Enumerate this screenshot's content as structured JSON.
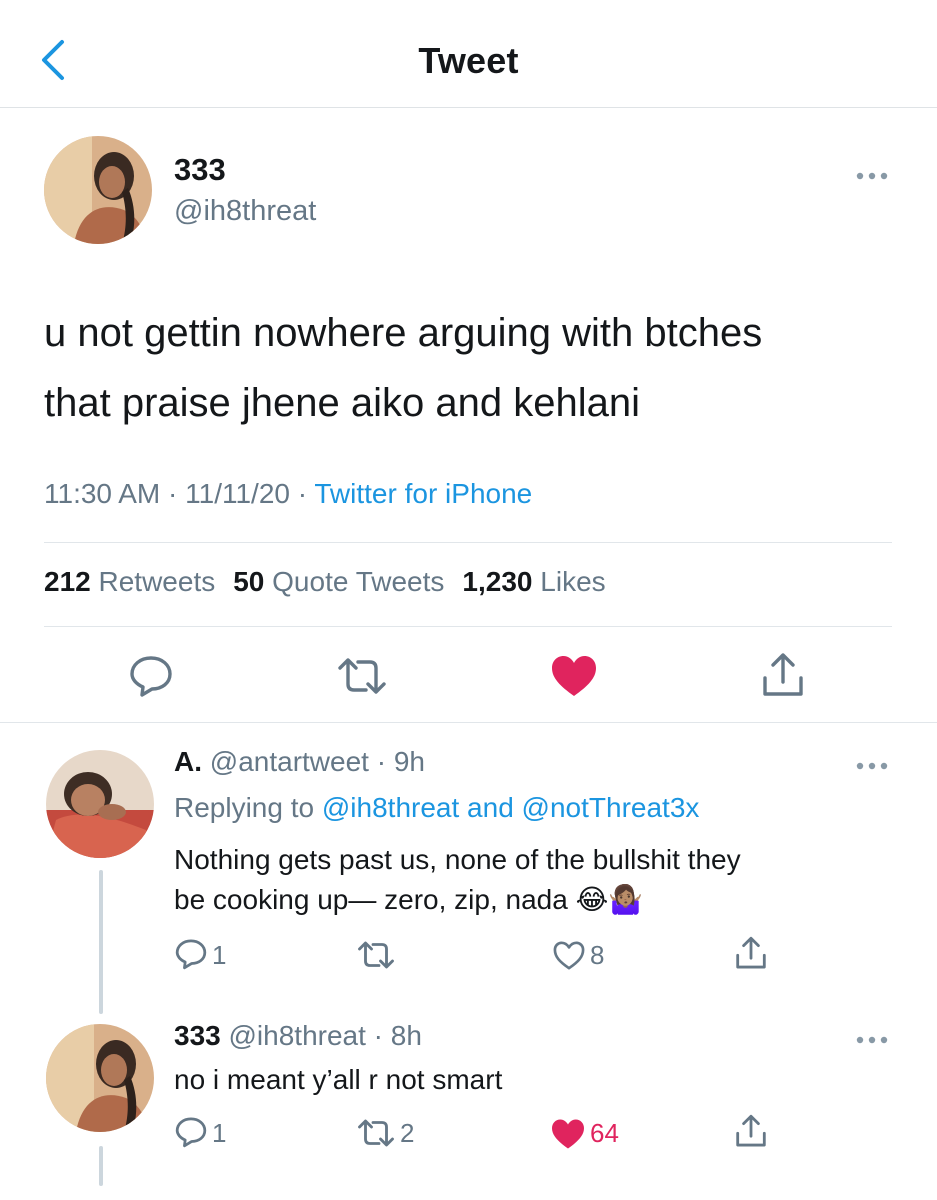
{
  "header": {
    "title": "Tweet"
  },
  "tweet": {
    "name": "333",
    "handle": "@ih8threat",
    "text_line1": "u not gettin nowhere arguing with btches",
    "text_line2": "that praise jhene aiko and kehlani",
    "time": "11:30 AM",
    "date": "11/11/20",
    "source": "Twitter for iPhone",
    "retweets": "212",
    "retweets_label": "Retweets",
    "quotes": "50",
    "quotes_label": "Quote Tweets",
    "likes": "1,230",
    "likes_label": "Likes",
    "liked": true
  },
  "replies": [
    {
      "name": "A.",
      "handle": "@antartweet",
      "age": "9h",
      "replying_prefix": "Replying to",
      "replying_user1": "@ih8threat",
      "replying_and": "and",
      "replying_user2": "@notThreat3x",
      "text_line1": "Nothing gets past us, none of the bullshit they",
      "text_line2": "be cooking up— zero, zip, nada",
      "emoji": "😂🤷🏽‍♀️",
      "reply_count": "1",
      "retweet_count": "",
      "like_count": "8",
      "liked": false
    },
    {
      "name": "333",
      "handle": "@ih8threat",
      "age": "8h",
      "text": "no i meant y’all r not smart",
      "reply_count": "1",
      "retweet_count": "2",
      "like_count": "64",
      "liked": true
    }
  ],
  "colors": {
    "accent": "#1b95e0",
    "like": "#e0245e",
    "secondary_text": "#657786",
    "divider": "#e1e6ea"
  },
  "icons": [
    "chevron-left-icon",
    "more-icon",
    "reply-icon",
    "retweet-icon",
    "heart-icon",
    "share-icon",
    "laughing-emoji",
    "shrug-emoji"
  ]
}
